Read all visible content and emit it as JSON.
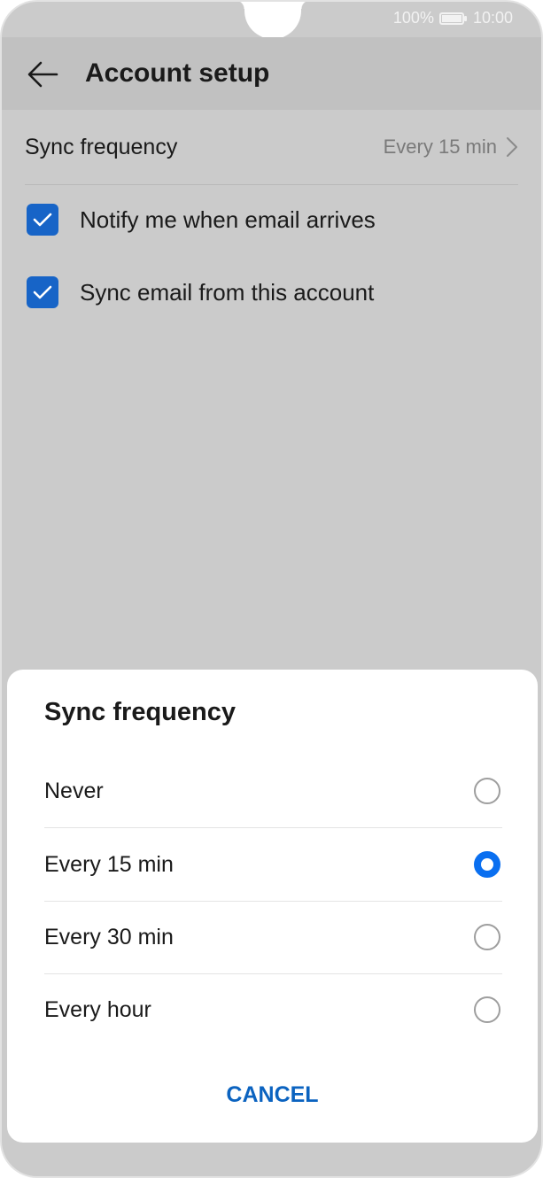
{
  "status_bar": {
    "battery": "100%",
    "time": "10:00"
  },
  "header": {
    "title": "Account setup",
    "back_icon": "arrow-left-icon"
  },
  "settings": {
    "sync_frequency_label": "Sync frequency",
    "sync_frequency_value": "Every 15 min",
    "checkboxes": [
      {
        "label": "Notify me when email arrives",
        "checked": true
      },
      {
        "label": "Sync email from this account",
        "checked": true
      }
    ]
  },
  "dialog": {
    "title": "Sync frequency",
    "options": [
      {
        "label": "Never",
        "selected": false
      },
      {
        "label": "Every 15 min",
        "selected": true
      },
      {
        "label": "Every 30 min",
        "selected": false
      },
      {
        "label": "Every hour",
        "selected": false
      }
    ],
    "cancel_label": "CANCEL"
  },
  "colors": {
    "accent": "#0a6ff0",
    "checkbox": "#1764c7",
    "cancel_text": "#0b63c0",
    "overlay_bg": "#cbcbcb"
  }
}
